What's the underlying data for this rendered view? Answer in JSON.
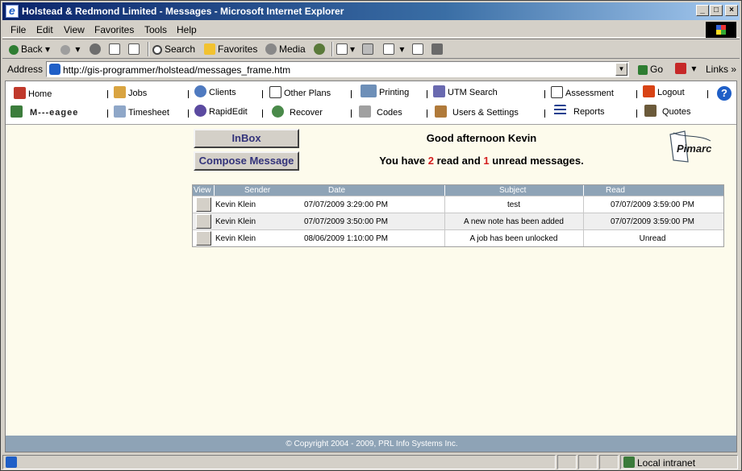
{
  "window": {
    "title": "Holstead & Redmond Limited - Messages - Microsoft Internet Explorer"
  },
  "menu": [
    "File",
    "Edit",
    "View",
    "Favorites",
    "Tools",
    "Help"
  ],
  "toolbar": {
    "back": "Back",
    "search": "Search",
    "favorites": "Favorites",
    "media": "Media"
  },
  "address": {
    "label": "Address",
    "url": "http://gis-programmer/holstead/messages_frame.htm",
    "go": "Go",
    "links": "Links"
  },
  "nav": {
    "row1": [
      "Home",
      "Jobs",
      "Clients",
      "Other Plans",
      "Printing",
      "UTM Search",
      "Assessment",
      "Logout"
    ],
    "row2": [
      "M---eagee",
      "Timesheet",
      "RapidEdit",
      "Recover",
      "Codes",
      "Users & Settings",
      "Reports",
      "Quotes"
    ]
  },
  "buttons": {
    "inbox": "InBox",
    "compose": "Compose Message"
  },
  "greeting": "Good afternoon Kevin",
  "summary": {
    "prefix": "You have ",
    "read_count": "2",
    "middle": " read and ",
    "unread_count": "1",
    "suffix": " unread messages."
  },
  "logo": {
    "text": "Pimarc"
  },
  "table": {
    "headers": [
      "View",
      "Sender",
      "Date",
      "Subject",
      "Read"
    ],
    "rows": [
      {
        "sender": "Kevin Klein",
        "date": "07/07/2009 3:29:00 PM",
        "subject": "test",
        "read": "07/07/2009 3:59:00 PM"
      },
      {
        "sender": "Kevin Klein",
        "date": "07/07/2009 3:50:00 PM",
        "subject": "A new note has been added",
        "read": "07/07/2009 3:59:00 PM"
      },
      {
        "sender": "Kevin Klein",
        "date": "08/06/2009 1:10:00 PM",
        "subject": "A job has been unlocked",
        "read": "Unread"
      }
    ]
  },
  "footer": "© Copyright 2004 - 2009, PRL Info Systems Inc.",
  "status": {
    "zone": "Local intranet"
  },
  "colors": {
    "accent": "#0a246a",
    "table_header": "#8ea3b6",
    "page_bg": "#fdfbec",
    "count_red": "#d31e1e"
  }
}
